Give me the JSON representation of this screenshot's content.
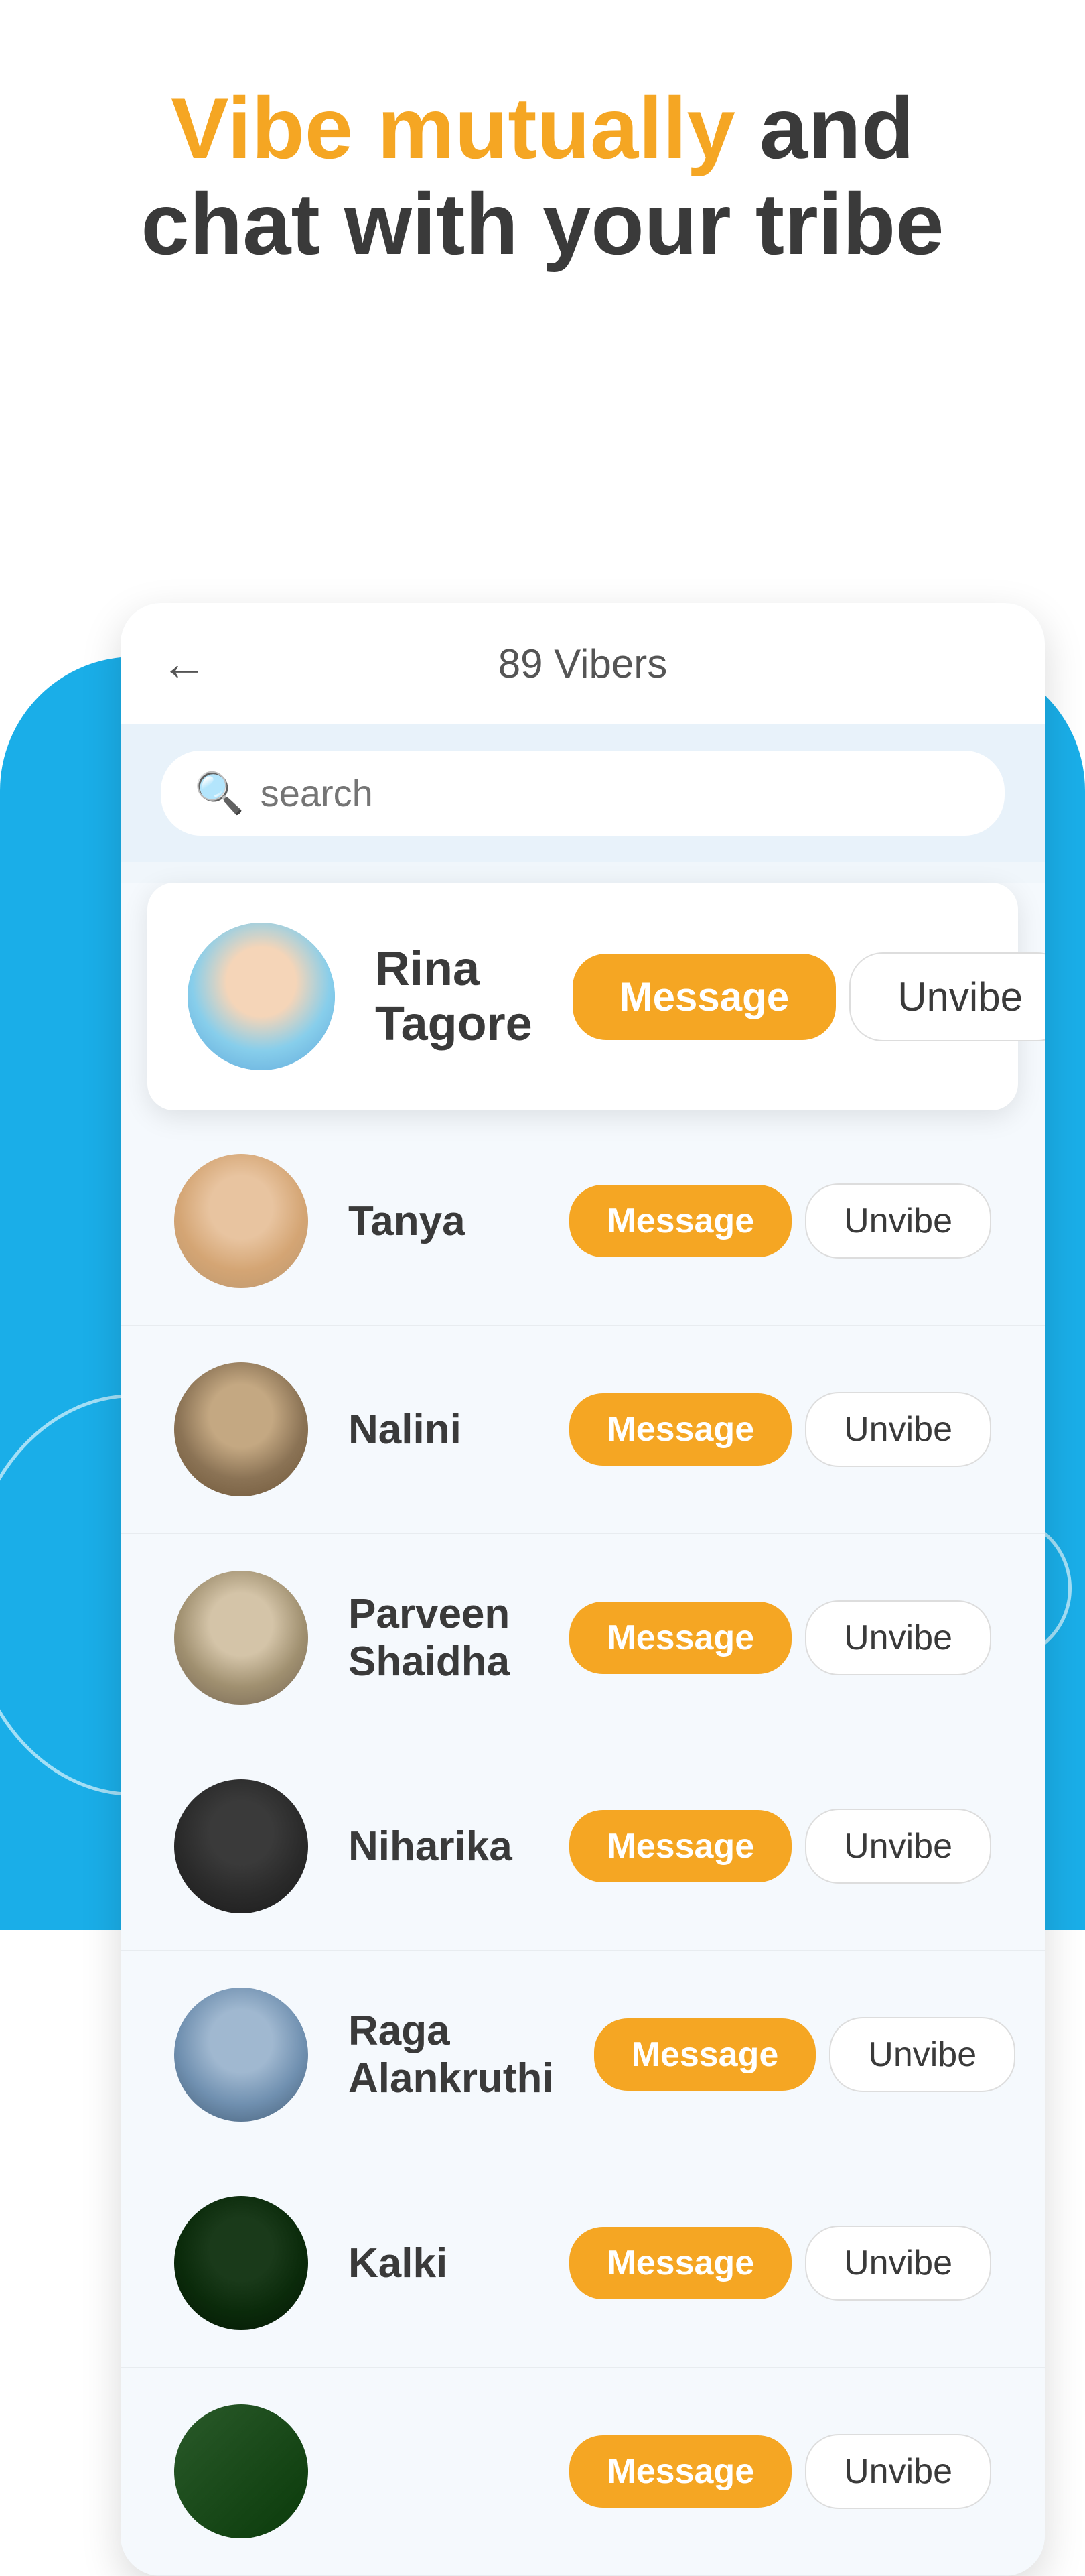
{
  "hero": {
    "line1_orange": "Vibe mutually",
    "line1_dark": " and",
    "line2": "chat with your tribe"
  },
  "panel": {
    "back_arrow": "←",
    "title": "89 Vibers",
    "search_placeholder": "search"
  },
  "users": [
    {
      "id": 1,
      "name": "Rina Tagore",
      "avatar_class": "face-rina",
      "featured": true
    },
    {
      "id": 2,
      "name": "Tanya",
      "avatar_class": "face-tanya",
      "featured": false
    },
    {
      "id": 3,
      "name": "Nalini",
      "avatar_class": "face-nalini",
      "featured": false
    },
    {
      "id": 4,
      "name": "Parveen Shaidha",
      "avatar_class": "face-parveen",
      "featured": false
    },
    {
      "id": 5,
      "name": "Niharika",
      "avatar_class": "face-niharika",
      "featured": false
    },
    {
      "id": 6,
      "name": "Raga Alankruthi",
      "avatar_class": "face-raga",
      "featured": false
    },
    {
      "id": 7,
      "name": "Kalki",
      "avatar_class": "face-kalki",
      "featured": false
    }
  ],
  "buttons": {
    "message": "Message",
    "unvibe": "Unvibe"
  },
  "colors": {
    "orange": "#F5A623",
    "blue": "#1aaee8",
    "dark_text": "#3a3a3a",
    "gray_text": "#555555"
  }
}
